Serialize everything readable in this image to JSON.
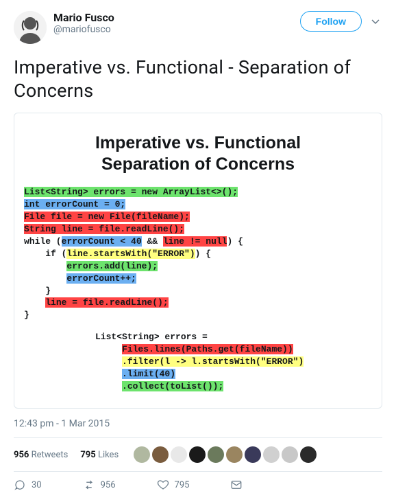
{
  "author": {
    "display_name": "Mario Fusco",
    "handle": "@mariofusco"
  },
  "follow_label": "Follow",
  "tweet_text": "Imperative vs. Functional - Separation of Concerns",
  "slide": {
    "title_line1": "Imperative vs. Functional",
    "title_line2": "Separation of Concerns",
    "imperative": {
      "l1": "List<String> errors = new ArrayList<>();",
      "l2": "int errorCount = 0;",
      "l3": "File file = new File(fileName);",
      "l4": "String line = file.readLine();",
      "l5_a": "while (",
      "l5_b": "errorCount < 40",
      "l5_c": " && ",
      "l5_d": "line != null",
      "l5_e": ") {",
      "l6_a": "    if (",
      "l6_b": "line.startsWith(\"ERROR\")",
      "l6_c": ") {",
      "l7": "errors.add(line);",
      "l7_pad": "        ",
      "l8": "errorCount++;",
      "l8_pad": "        ",
      "l9": "    }",
      "l10": "line = file.readLine();",
      "l10_pad": "    ",
      "l11": "}"
    },
    "functional": {
      "l1": "List<String> errors =",
      "l2": "Files.lines(Paths.get(fileName))",
      "l2_pad": "     ",
      "l3": ".filter(l -> l.startsWith(\"ERROR\")",
      "l3_pad": "     ",
      "l4": ".limit(40)",
      "l4_pad": "     ",
      "l5": ".collect(toList());",
      "l5_pad": "     "
    }
  },
  "timestamp": "12:43 pm - 1 Mar 2015",
  "counts": {
    "retweets_n": "956",
    "retweets_l": "Retweets",
    "likes_n": "795",
    "likes_l": "Likes"
  },
  "actions": {
    "replies": "30",
    "retweets": "956",
    "likes": "795"
  },
  "facepile_colors": [
    "#b0b8a0",
    "#7a5c3e",
    "#e8e8e8",
    "#1a1a1a",
    "#6b7a5c",
    "#9a8560",
    "#3a3a5a",
    "#d0d0d0",
    "#c8c8c8",
    "#2a2a2a"
  ]
}
